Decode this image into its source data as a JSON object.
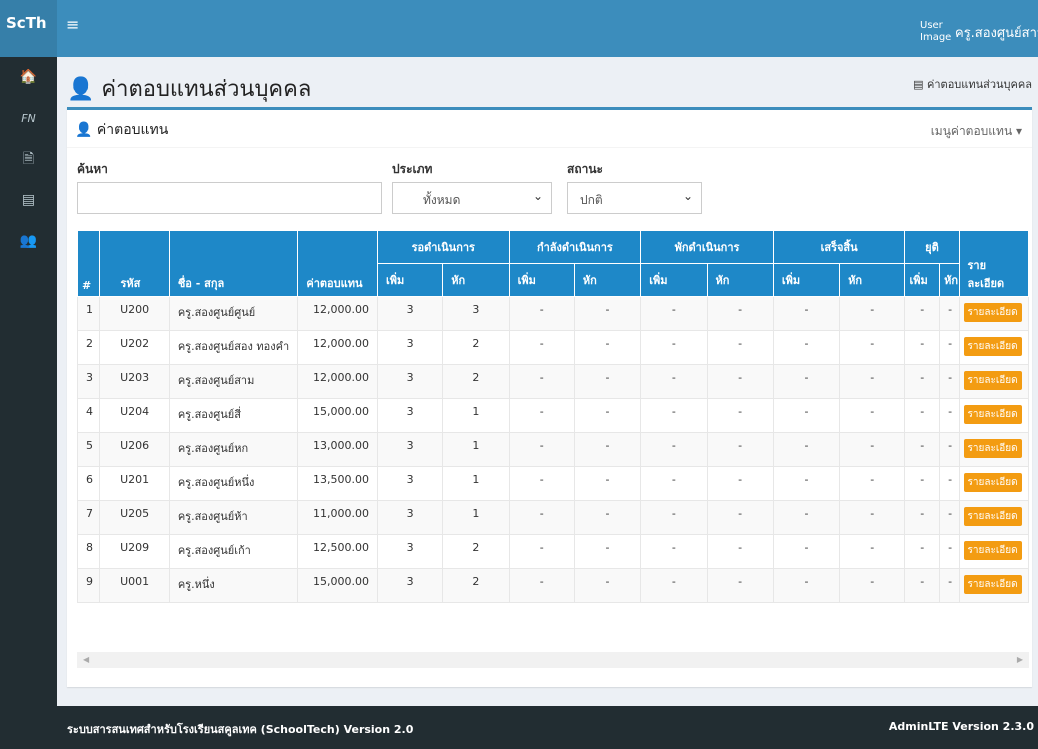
{
  "header": {
    "logo": "ScTh",
    "toggle_icon": "≡",
    "user_image_alt": "User Image",
    "user_name": "ครู.สองศูนย์สาม"
  },
  "sidebar": {
    "items": [
      {
        "icon": "home-icon",
        "glyph": "🏠"
      },
      {
        "icon": "fn-icon",
        "glyph": "FN"
      },
      {
        "icon": "document-icon",
        "glyph": "🗎"
      },
      {
        "icon": "card-icon",
        "glyph": "▤"
      },
      {
        "icon": "users-icon",
        "glyph": "👥"
      }
    ]
  },
  "page": {
    "title": "ค่าตอบแทนส่วนบุคคล",
    "breadcrumb": "ค่าตอบแทนส่วนบุคคล"
  },
  "box": {
    "title": "ค่าตอบแทน",
    "menu": "เมนูค่าตอบแทน"
  },
  "filters": {
    "search_label": "ค้นหา",
    "search_value": "",
    "type_label": "ประเภท",
    "type_value": "ทั้งหมด",
    "status_label": "สถานะ",
    "status_value": "ปกติ"
  },
  "table": {
    "headers": {
      "no": "#",
      "code": "รหัส",
      "name": "ชื่อ - สกุล",
      "amount": "ค่าตอบแทน",
      "pending": "รอดำเนินการ",
      "processing": "กำลังดำเนินการ",
      "paused": "พักดำเนินการ",
      "done": "เสร็จสิ้น",
      "stopped": "ยุติ",
      "detail": "รายละเอียด",
      "add": "เพิ่ม",
      "deduct": "หัก"
    },
    "rows": [
      {
        "no": "1",
        "code": "U200",
        "name": "ครู.สองศูนย์ศูนย์",
        "amount": "12,000.00",
        "pa": "3",
        "pd": "3",
        "cells": [
          "-",
          "-",
          "-",
          "-",
          "-",
          "-",
          "-",
          "-"
        ],
        "btn": "รายละเอียด"
      },
      {
        "no": "2",
        "code": "U202",
        "name": "ครู.สองศูนย์สอง ทองคำ",
        "amount": "12,000.00",
        "pa": "3",
        "pd": "2",
        "cells": [
          "-",
          "-",
          "-",
          "-",
          "-",
          "-",
          "-",
          "-"
        ],
        "btn": "รายละเอียด"
      },
      {
        "no": "3",
        "code": "U203",
        "name": "ครู.สองศูนย์สาม",
        "amount": "12,000.00",
        "pa": "3",
        "pd": "2",
        "cells": [
          "-",
          "-",
          "-",
          "-",
          "-",
          "-",
          "-",
          "-"
        ],
        "btn": "รายละเอียด"
      },
      {
        "no": "4",
        "code": "U204",
        "name": "ครู.สองศูนย์สี่",
        "amount": "15,000.00",
        "pa": "3",
        "pd": "1",
        "cells": [
          "-",
          "-",
          "-",
          "-",
          "-",
          "-",
          "-",
          "-"
        ],
        "btn": "รายละเอียด"
      },
      {
        "no": "5",
        "code": "U206",
        "name": "ครู.สองศูนย์หก",
        "amount": "13,000.00",
        "pa": "3",
        "pd": "1",
        "cells": [
          "-",
          "-",
          "-",
          "-",
          "-",
          "-",
          "-",
          "-"
        ],
        "btn": "รายละเอียด"
      },
      {
        "no": "6",
        "code": "U201",
        "name": "ครู.สองศูนย์หนึ่ง",
        "amount": "13,500.00",
        "pa": "3",
        "pd": "1",
        "cells": [
          "-",
          "-",
          "-",
          "-",
          "-",
          "-",
          "-",
          "-"
        ],
        "btn": "รายละเอียด"
      },
      {
        "no": "7",
        "code": "U205",
        "name": "ครู.สองศูนย์ห้า",
        "amount": "11,000.00",
        "pa": "3",
        "pd": "1",
        "cells": [
          "-",
          "-",
          "-",
          "-",
          "-",
          "-",
          "-",
          "-"
        ],
        "btn": "รายละเอียด"
      },
      {
        "no": "8",
        "code": "U209",
        "name": "ครู.สองศูนย์เก้า",
        "amount": "12,500.00",
        "pa": "3",
        "pd": "2",
        "cells": [
          "-",
          "-",
          "-",
          "-",
          "-",
          "-",
          "-",
          "-"
        ],
        "btn": "รายละเอียด"
      },
      {
        "no": "9",
        "code": "U001",
        "name": "ครู.หนึ่ง",
        "amount": "15,000.00",
        "pa": "3",
        "pd": "2",
        "cells": [
          "-",
          "-",
          "-",
          "-",
          "-",
          "-",
          "-",
          "-"
        ],
        "btn": "รายละเอียด"
      }
    ]
  },
  "footer": {
    "left": "ระบบสารสนเทศสำหรับโรงเรียนสคูลเทค (SchoolTech) Version 2.0",
    "right": "AdminLTE Version 2.3.0"
  },
  "colors": {
    "header": "#3c8dbc",
    "sidebar": "#222d32",
    "table_head": "#1e88c8",
    "button": "#f39c12"
  }
}
